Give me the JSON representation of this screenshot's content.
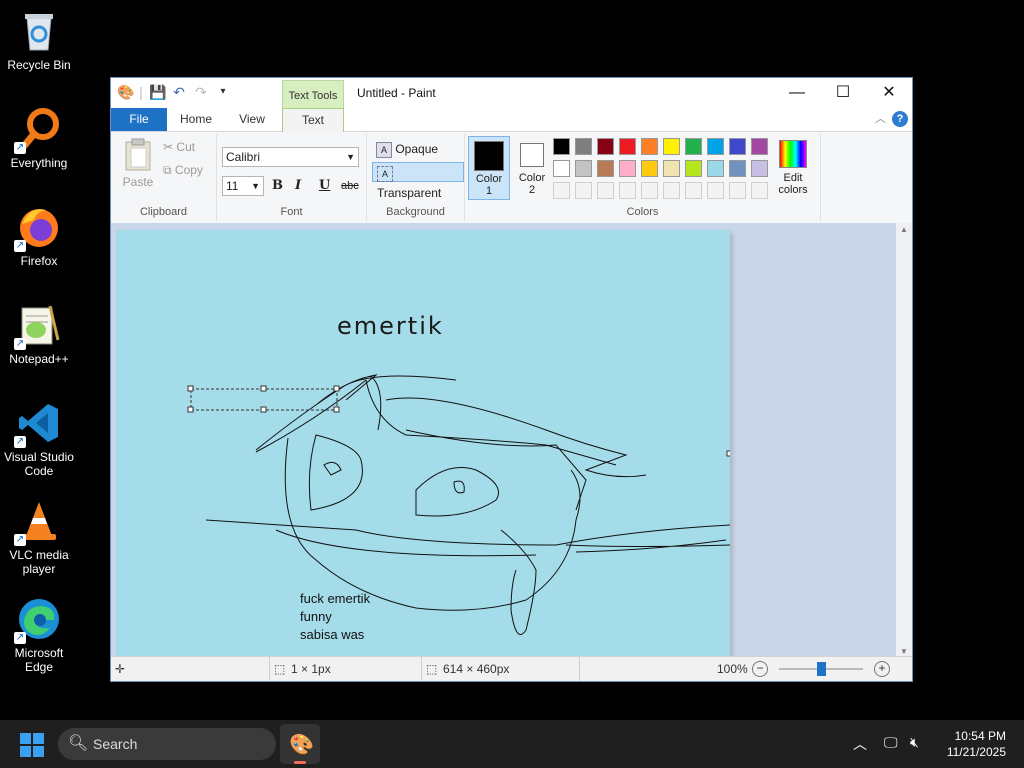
{
  "desktop": {
    "icons": [
      {
        "label": "Recycle Bin"
      },
      {
        "label": "Everything"
      },
      {
        "label": "Firefox"
      },
      {
        "label": "Notepad++"
      },
      {
        "label": "Visual Studio Code"
      },
      {
        "label": "VLC media player"
      },
      {
        "label": "Microsoft Edge"
      }
    ]
  },
  "window": {
    "title": "Untitled - Paint",
    "context_tab": "Text Tools",
    "tabs": [
      "File",
      "Home",
      "View",
      "Text"
    ],
    "active_tab": "Text"
  },
  "ribbon": {
    "clipboard": {
      "paste": "Paste",
      "cut": "Cut",
      "copy": "Copy",
      "label": "Clipboard"
    },
    "font": {
      "family": "Calibri",
      "size": "11",
      "bold": "B",
      "italic": "I",
      "underline": "U",
      "strike": "abc",
      "label": "Font"
    },
    "background": {
      "opaque": "Opaque",
      "transparent": "Transparent",
      "label": "Background"
    },
    "colors": {
      "color1_label_a": "Color",
      "color1_label_b": "1",
      "color2_label_a": "Color",
      "color2_label_b": "2",
      "edit_a": "Edit",
      "edit_b": "colors",
      "label": "Colors",
      "color1": "#000000",
      "color2": "#ffffff",
      "palette_row1": [
        "#000000",
        "#7f7f7f",
        "#880015",
        "#ed1c24",
        "#ff7f27",
        "#fff200",
        "#22b14c",
        "#00a2e8",
        "#3f48cc",
        "#a349a4"
      ],
      "palette_row2": [
        "#ffffff",
        "#c3c3c3",
        "#b97a57",
        "#ffaec9",
        "#ffc90e",
        "#efe4b0",
        "#b5e61d",
        "#99d9ea",
        "#7092be",
        "#c8bfe7"
      ]
    }
  },
  "canvas": {
    "bg": "#a5dce9",
    "heading_text": "emertik",
    "text_lines": [
      "fuck emertik",
      "funny",
      "sabisa was"
    ]
  },
  "status": {
    "selection_size": "1 × 1px",
    "image_size": "614 × 460px",
    "zoom": "100%",
    "zoom_fraction": 0.5
  },
  "taskbar": {
    "search_placeholder": "Search",
    "time": "10:54 PM",
    "date": "11/21/2025"
  }
}
